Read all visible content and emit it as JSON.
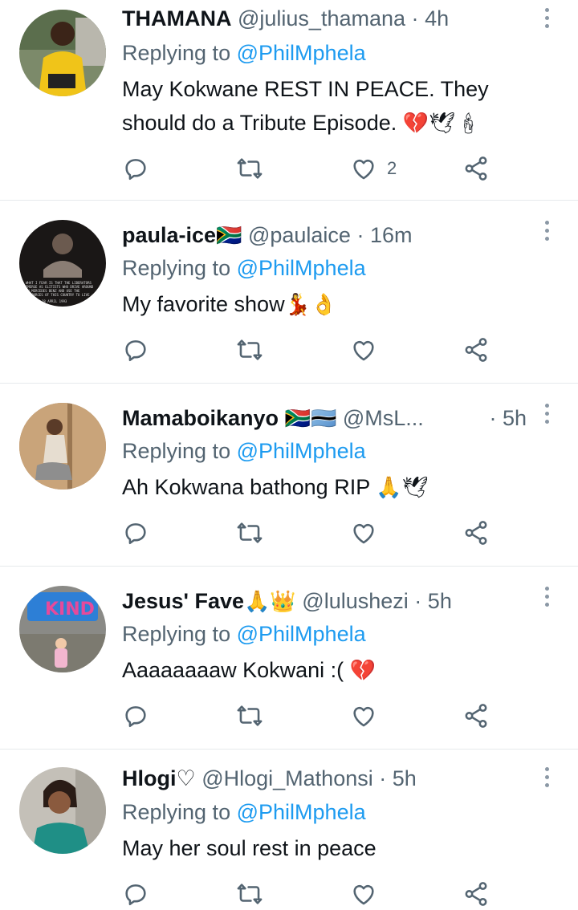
{
  "tweets": [
    {
      "name": "THAMANA",
      "handle": "@julius_thamana",
      "separator": "·",
      "time": "4h",
      "reply_prefix": "Replying to",
      "mention": "@PhilMphela",
      "text_line1": "May Kokwane REST IN PEACE. They",
      "text_line2": "should do a Tribute Episode.",
      "emoji": "💔🕊🕯",
      "like_count": "2"
    },
    {
      "name": "paula-ice",
      "name_emoji": "🇿🇦",
      "handle": "@paulaice",
      "separator": "·",
      "time": "16m",
      "reply_prefix": "Replying to",
      "mention": "@PhilMphela",
      "text": "My favorite show",
      "emoji": "💃👌",
      "avatar_text": "WHAT I FEAR IS THAT THE LIBERATORS EMERGE AS ELITISTS WHO DRIVE AROUND IN MERCEDES BENZ AND USE THE RESOURCES OF THIS COUNTRY TO LIVE IN PALACES AND GATHER RICHES — O. MAKE 1992 — 28 APRIL 1993"
    },
    {
      "name": "Mamaboikanyo",
      "name_emoji": "🇿🇦🇧🇼",
      "handle": "@MsL...",
      "separator": "·",
      "time": "5h",
      "reply_prefix": "Replying to",
      "mention": "@PhilMphela",
      "text": "Ah Kokwana bathong RIP",
      "emoji": "🙏🕊"
    },
    {
      "name": "Jesus' Fave",
      "name_emoji": "🙏👑",
      "handle": "@lulushezi",
      "separator": "·",
      "time": "5h",
      "reply_prefix": "Replying to",
      "mention": "@PhilMphela",
      "text": "Aaaaaaaaw Kokwani :(",
      "emoji": "💔",
      "avatar_text": "KIND"
    },
    {
      "name": "Hlogi♡",
      "handle": "@Hlogi_Mathonsi",
      "separator": "·",
      "time": "5h",
      "reply_prefix": "Replying to",
      "mention": "@PhilMphela",
      "text": "May her soul rest in peace"
    }
  ],
  "colors": {
    "text": "#0f1419",
    "secondary": "#536471",
    "link": "#1d9bf0",
    "divider": "#e6e9ec"
  },
  "icons": [
    "reply-icon",
    "retweet-icon",
    "like-icon",
    "share-icon",
    "more-icon"
  ]
}
